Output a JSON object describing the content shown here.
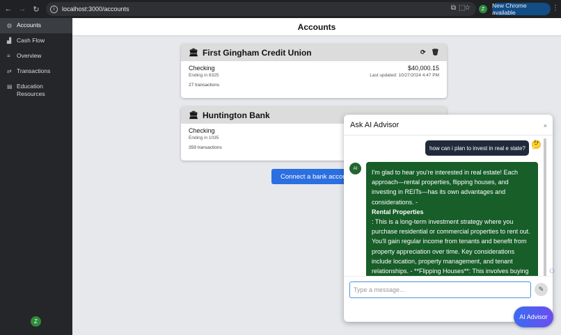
{
  "browser": {
    "url": "localhost:3000/accounts",
    "new_chrome": "New Chrome available",
    "profile_initial": "Z"
  },
  "sidebar": {
    "items": [
      {
        "label": "Accounts",
        "icon": "wallet-icon"
      },
      {
        "label": "Cash Flow",
        "icon": "chart-icon"
      },
      {
        "label": "Overview",
        "icon": "list-icon"
      },
      {
        "label": "Transactions",
        "icon": "swap-icon"
      },
      {
        "label": "Education Resources",
        "icon": "book-icon"
      }
    ],
    "user_initial": "Z"
  },
  "page": {
    "title": "Accounts"
  },
  "accounts": [
    {
      "bank": "First Gingham Credit Union",
      "type": "Checking",
      "ending": "Ending in 8325",
      "transactions": "27 transactions",
      "balance": "$40,000.15",
      "updated": "Last updated: 10/27/2024 4:47 PM"
    },
    {
      "bank": "Huntington Bank",
      "type": "Checking",
      "ending": "Ending in 1035",
      "transactions": "359 transactions"
    }
  ],
  "connect_button": "Connect a bank accou",
  "advisor": {
    "title": "Ask AI Advisor",
    "close": "×",
    "user_message": "how can i plan to invest in real e state?",
    "user_emoji": "🤔",
    "ai_avatar": "AI",
    "ai_message_intro": "I'm glad to hear you're interested in real estate! Each approach—rental properties, flipping houses, and investing in REITs—has its own advantages and considerations. -",
    "ai_message_heading": "Rental Properties",
    "ai_message_body": ": This is a long-term investment strategy where you purchase residential or commercial properties to rent out. You'll gain regular income from tenants and benefit from property appreciation over time. Key considerations include location, property management, and tenant relationships. - **Flipping Houses**: This involves buying",
    "input_placeholder": "Type a message...",
    "fab_label": "AI Advisor"
  }
}
